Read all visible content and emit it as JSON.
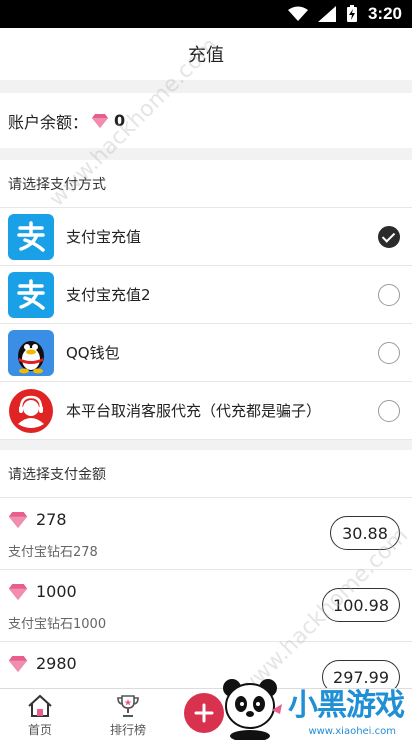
{
  "status_bar": {
    "time": "3:20"
  },
  "header": {
    "title": "充值"
  },
  "balance": {
    "label": "账户余额：",
    "value": "0"
  },
  "payment": {
    "section_title": "请选择支付方式",
    "methods": [
      {
        "label": "支付宝充值",
        "icon": "alipay-icon",
        "selected": true
      },
      {
        "label": "支付宝充值2",
        "icon": "alipay-icon",
        "selected": false
      },
      {
        "label": "QQ钱包",
        "icon": "qq-penguin-icon",
        "selected": false
      },
      {
        "label": "本平台取消客服代充（代充都是骗子）",
        "icon": "customer-service-icon",
        "selected": false
      }
    ]
  },
  "amount": {
    "section_title": "请选择支付金额",
    "items": [
      {
        "diamonds": "278",
        "desc": "支付宝钻石278",
        "price": "30.88"
      },
      {
        "diamonds": "1000",
        "desc": "支付宝钻石1000",
        "price": "100.98"
      },
      {
        "diamonds": "2980",
        "desc": "",
        "price": "297.99"
      }
    ]
  },
  "tabbar": {
    "items": [
      {
        "label": "首页",
        "icon": "home-icon"
      },
      {
        "label": "排行榜",
        "icon": "trophy-icon"
      }
    ]
  },
  "watermark": {
    "site": "www.hackhome.com",
    "brand_name": "小黑游戏",
    "brand_url": "www.xiaohei.com"
  },
  "colors": {
    "diamond": "#e85d8a",
    "alipay": "#1aa0e6",
    "plus": "#d8324f",
    "brand": "#1f8fd6"
  }
}
